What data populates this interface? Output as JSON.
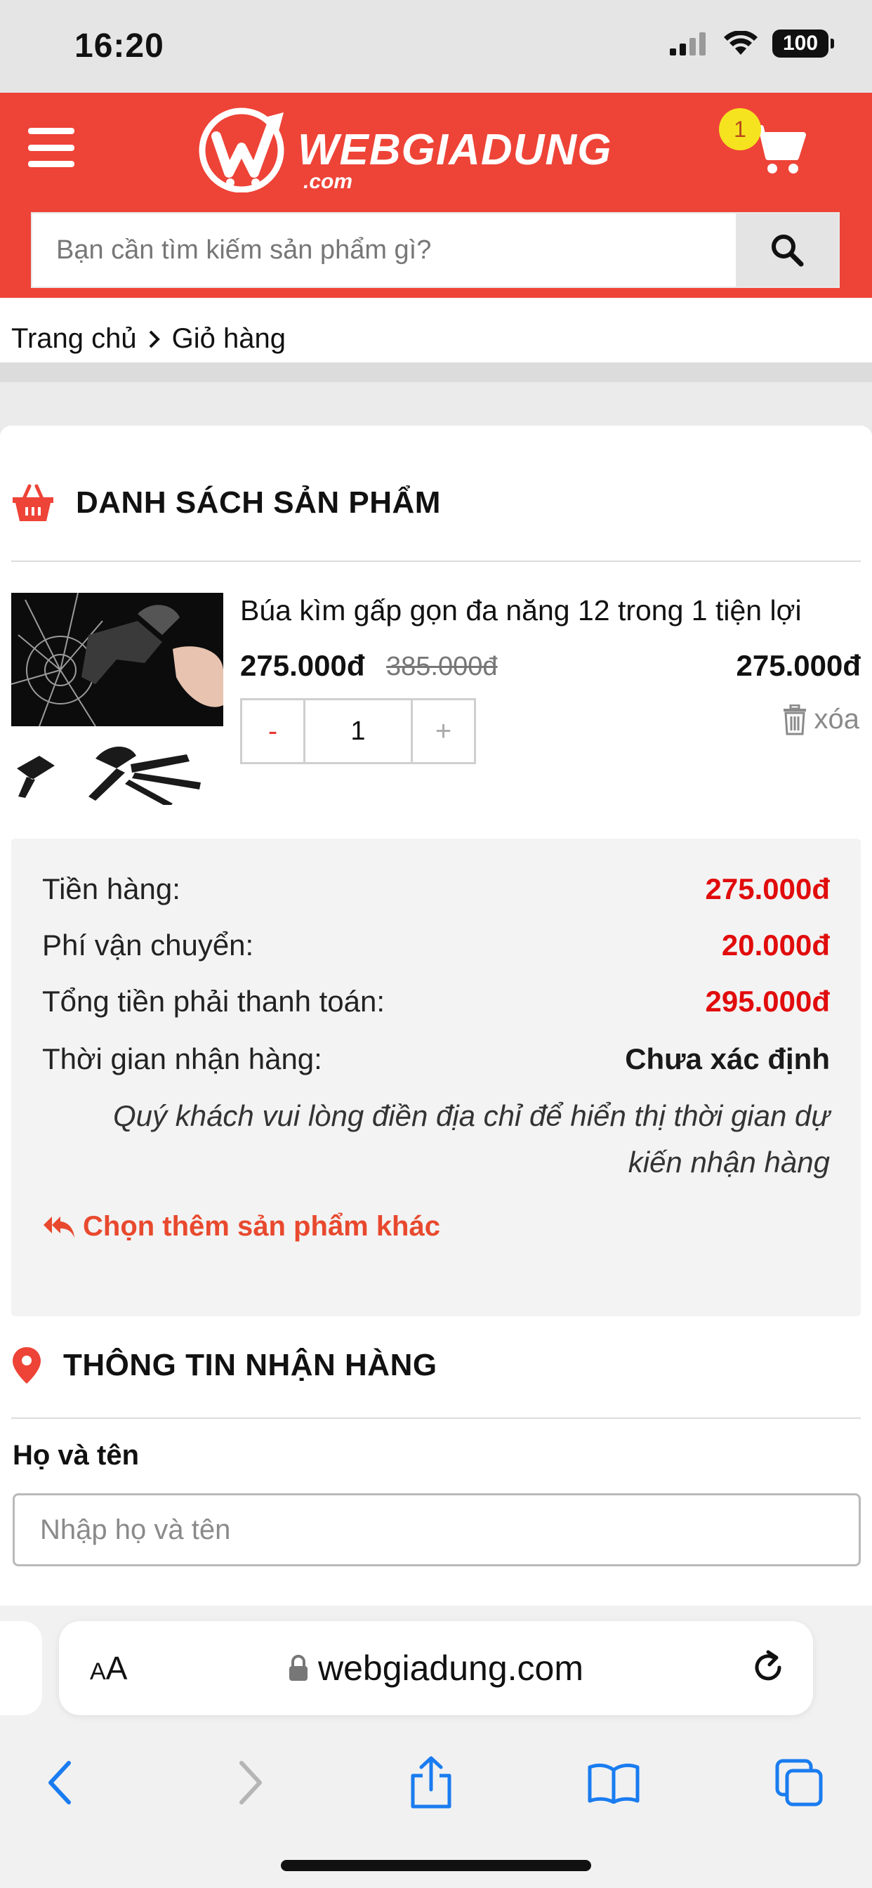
{
  "status_bar": {
    "time": "16:20",
    "battery": "100"
  },
  "header": {
    "logo_text": "WEBGIADUNG",
    "logo_sub": ".com",
    "cart_count": "1",
    "search_placeholder": "Bạn cần tìm kiếm sản phẩm gì?",
    "brand_color": "#ee4337"
  },
  "breadcrumb": {
    "home": "Trang chủ",
    "current": "Giỏ hàng"
  },
  "cart": {
    "section_title": "DANH SÁCH SẢN PHẨM",
    "item": {
      "name": "Búa kìm gấp gọn đa năng 12 trong 1 tiện lợi",
      "price": "275.000đ",
      "old_price": "385.000đ",
      "line_total": "275.000đ",
      "quantity": "1",
      "minus_label": "-",
      "plus_label": "+",
      "delete_label": "xóa"
    }
  },
  "summary": {
    "subtotal_label": "Tiền hàng:",
    "subtotal_value": "275.000đ",
    "shipping_label": "Phí vận chuyển:",
    "shipping_value": "20.000đ",
    "total_label": "Tổng tiền phải thanh toán:",
    "total_value": "295.000đ",
    "delivery_label": "Thời gian nhận hàng:",
    "delivery_value": "Chưa xác định",
    "note": "Quý khách vui lòng điền địa chỉ để hiển thị thời gian dự kiến nhận hàng",
    "more_link": "Chọn thêm sản phẩm khác"
  },
  "shipping_info": {
    "section_title": "THÔNG TIN NHẬN HÀNG",
    "name_label": "Họ và tên",
    "name_placeholder": "Nhập họ và tên"
  },
  "safari": {
    "aa_small": "A",
    "aa_big": "A",
    "url": "webgiadung.com"
  }
}
